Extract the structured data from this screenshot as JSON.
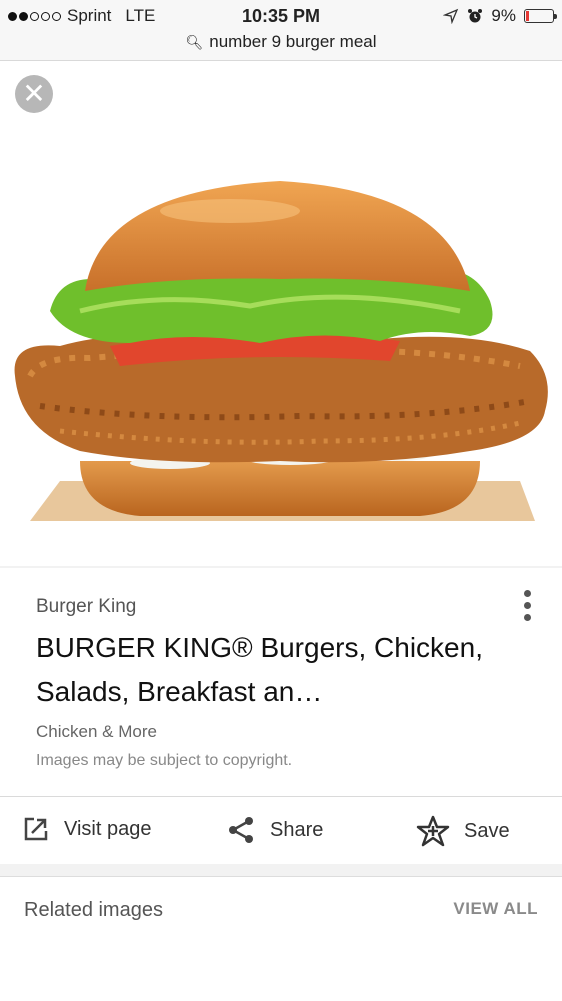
{
  "status_bar": {
    "carrier": "Sprint",
    "network": "LTE",
    "time": "10:35 PM",
    "battery": "9%",
    "battery_level": 0.09,
    "url": "number 9 burger meal"
  },
  "image_view": {
    "close_icon": "close-icon",
    "image_subject": "chicken-sandwich-image"
  },
  "result_card": {
    "source": "Burger King",
    "title": "BURGER KING® Burgers, Chicken, Salads, Breakfast an…",
    "description": "Chicken & More",
    "copyright_note": "Images may be subject to copyright.",
    "actions": {
      "visit_label": "Visit page",
      "share_label": "Share",
      "save_label": "Save"
    }
  },
  "related": {
    "title": "Related images",
    "view_all_label": "VIEW ALL"
  }
}
